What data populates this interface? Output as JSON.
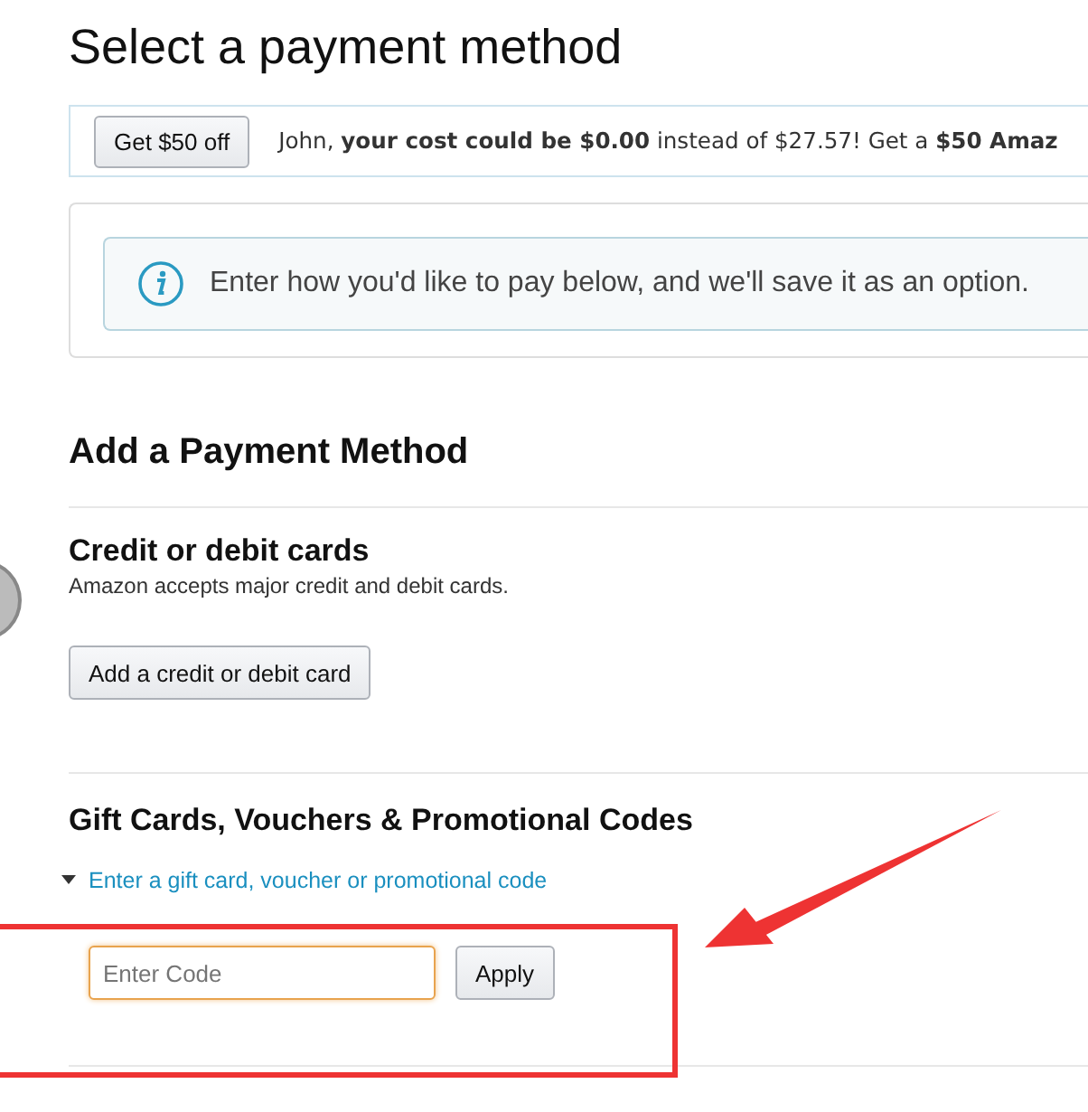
{
  "page_title": "Select a payment method",
  "promo": {
    "button": "Get $50 off",
    "message": "John, **your cost could be $0.00** instead of $27.57! Get a **$50 Amaz**"
  },
  "info": {
    "message": "Enter how you'd like to pay below, and we'll save it as an option."
  },
  "section_title": "Add a Payment Method",
  "cards": {
    "heading": "Credit or debit cards",
    "description": "Amazon accepts major credit and debit cards.",
    "button": "Add a credit or debit card"
  },
  "gift": {
    "heading": "Gift Cards, Vouchers & Promotional Codes",
    "link": "Enter a gift card, voucher or promotional code",
    "expanded": true,
    "placeholder": "Enter Code",
    "apply": "Apply"
  }
}
